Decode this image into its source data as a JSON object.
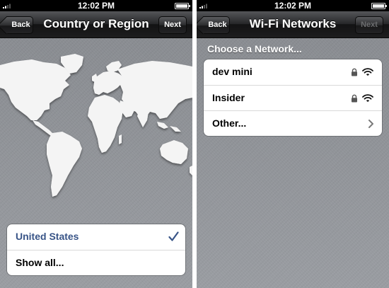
{
  "time": "12:02 PM",
  "colors": {
    "selected_text": "#385487",
    "nav_dark": "#1d1d1e",
    "background": "#8e9196"
  },
  "left_screen": {
    "nav": {
      "back_label": "Back",
      "title": "Country or Region",
      "next_label": "Next"
    },
    "countries": [
      {
        "label": "United States",
        "selected": true
      },
      {
        "label": "Show all...",
        "selected": false
      }
    ]
  },
  "right_screen": {
    "nav": {
      "back_label": "Back",
      "title": "Wi-Fi Networks",
      "next_label": "Next",
      "next_enabled": false
    },
    "section_header": "Choose a Network...",
    "networks": [
      {
        "label": "dev mini",
        "secured": true,
        "icon": "wifi-icon"
      },
      {
        "label": "Insider",
        "secured": true,
        "icon": "wifi-icon"
      },
      {
        "label": "Other...",
        "secured": false,
        "icon": "chevron-right-icon"
      }
    ]
  }
}
